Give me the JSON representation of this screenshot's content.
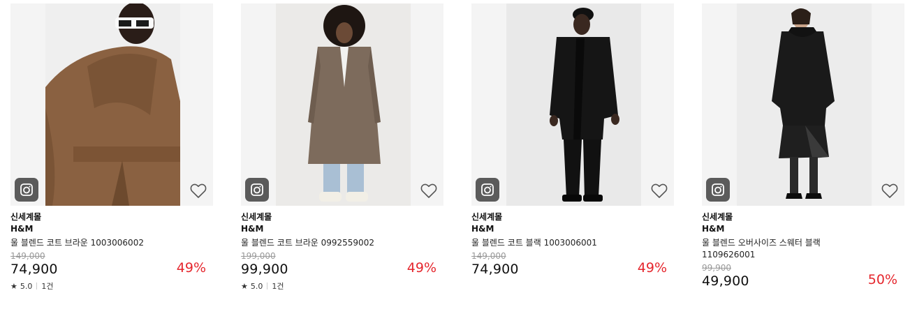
{
  "products": [
    {
      "store": "신세계몰",
      "brand": "H&M",
      "name": "울 블렌드 코트 브라운 1003006002",
      "original_price": "149,000",
      "price": "74,900",
      "discount": "49%",
      "rating": "5.0",
      "reviews": "1건",
      "photo_bg": "#f1f1f1",
      "garment_color": "#8a6141"
    },
    {
      "store": "신세계몰",
      "brand": "H&M",
      "name": "울 블렌드 코트 브라운 0992559002",
      "original_price": "199,000",
      "price": "99,900",
      "discount": "49%",
      "rating": "5.0",
      "reviews": "1건",
      "photo_bg": "#ebeae8",
      "garment_color": "#7d6b5c"
    },
    {
      "store": "신세계몰",
      "brand": "H&M",
      "name": "울 블렌드 코트 블랙 1003006001",
      "original_price": "149,000",
      "price": "74,900",
      "discount": "49%",
      "photo_bg": "#e9e9e9",
      "garment_color": "#151515"
    },
    {
      "store": "신세계몰",
      "brand": "H&M",
      "name": "울 블렌드 오버사이즈 스웨터 블랙 1109626001",
      "original_price": "99,900",
      "price": "49,900",
      "discount": "50%",
      "photo_bg": "#ececec",
      "garment_color": "#1a1a1a"
    }
  ],
  "icons": {
    "camera": "camera-icon",
    "wishlist": "heart-outline-icon",
    "star": "star-icon"
  },
  "colors": {
    "discount": "#e5262d",
    "original_price": "#999999"
  }
}
